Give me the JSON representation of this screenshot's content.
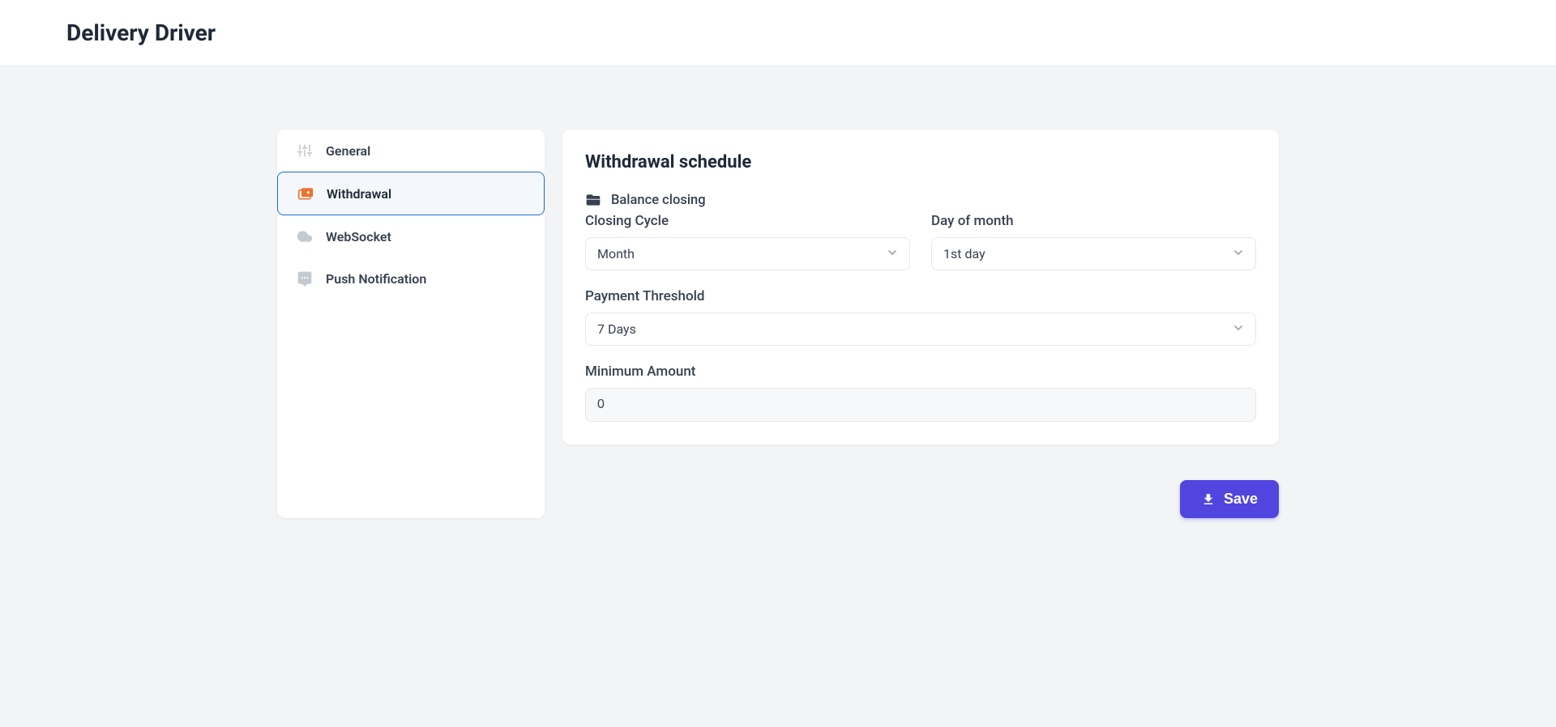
{
  "header": {
    "title": "Delivery Driver"
  },
  "sidebar": {
    "items": [
      {
        "label": "General",
        "icon": "sliders-icon",
        "active": false
      },
      {
        "label": "Withdrawal",
        "icon": "wallet-icon",
        "active": true
      },
      {
        "label": "WebSocket",
        "icon": "cloud-icon",
        "active": false
      },
      {
        "label": "Push Notification",
        "icon": "message-icon",
        "active": false
      }
    ]
  },
  "main": {
    "title": "Withdrawal schedule",
    "section_label": "Balance closing",
    "closing_cycle": {
      "label": "Closing Cycle",
      "value": "Month"
    },
    "day_of_month": {
      "label": "Day of month",
      "value": "1st day"
    },
    "payment_threshold": {
      "label": "Payment Threshold",
      "value": "7 Days"
    },
    "minimum_amount": {
      "label": "Minimum Amount",
      "value": "0"
    }
  },
  "actions": {
    "save_label": "Save"
  }
}
